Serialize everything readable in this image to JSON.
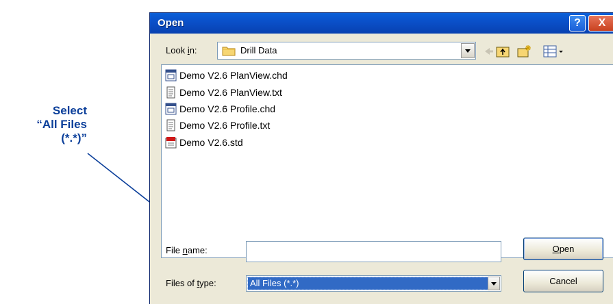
{
  "annotation": {
    "lines": [
      "Select",
      "“All Files",
      "(*.*)”"
    ]
  },
  "dialog": {
    "title": "Open",
    "help_label": "?",
    "close_label": "X"
  },
  "look_in": {
    "label_pre": "Look ",
    "label_ul": "i",
    "label_post": "n:",
    "value": "Drill Data"
  },
  "files": [
    {
      "name": "Demo V2.6 PlanView.chd",
      "icon": "chd-file-icon"
    },
    {
      "name": "Demo V2.6 PlanView.txt",
      "icon": "text-file-icon"
    },
    {
      "name": "Demo V2.6 Profile.chd",
      "icon": "chd-file-icon"
    },
    {
      "name": "Demo V2.6 Profile.txt",
      "icon": "text-file-icon"
    },
    {
      "name": "Demo V2.6.std",
      "icon": "std-file-icon"
    }
  ],
  "file_name": {
    "label_pre": "File ",
    "label_ul": "n",
    "label_post": "ame:",
    "value": ""
  },
  "file_type": {
    "label_pre": "Files of ",
    "label_ul": "t",
    "label_post": "ype:",
    "value": "All Files (*.*)"
  },
  "buttons": {
    "open_ul": "O",
    "open_rest": "pen",
    "cancel": "Cancel"
  },
  "colors": {
    "annotation": "#0b3f9a",
    "titlebar": "#0a4fc8",
    "selection": "#316ac5"
  }
}
